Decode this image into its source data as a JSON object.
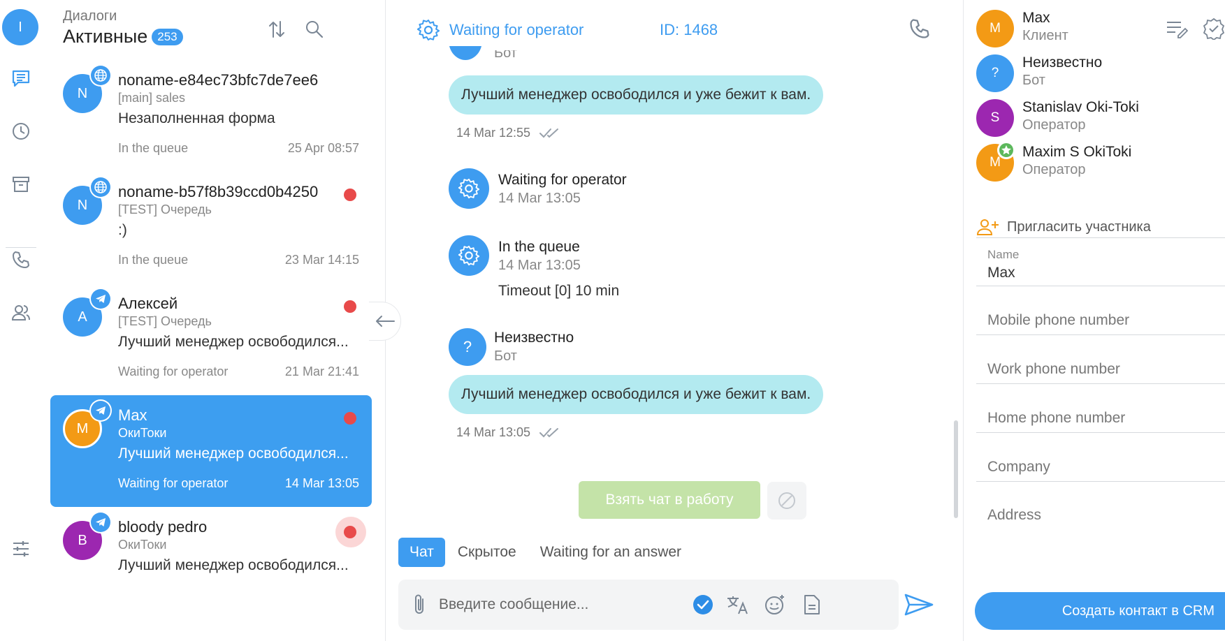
{
  "colors": {
    "accent": "#3e9cf0",
    "unread": "#e84a4a",
    "bubble": "#b3eaf0",
    "take_button": "#c4e3a8"
  },
  "user": {
    "initial": "I"
  },
  "rail": {
    "icons": [
      "chat-icon",
      "history-icon",
      "archive-icon",
      "phone-icon",
      "contacts-icon",
      "settings-sliders-icon"
    ]
  },
  "dialogs": {
    "section": "Диалоги",
    "title": "Активные",
    "count": "253",
    "items": [
      {
        "initial": "N",
        "avatar_color": "#3e9cf0",
        "channel": "web",
        "name": "noname-e84ec73bfc7de7ee6",
        "sub": "[main] sales",
        "message": "Незаполненная форма",
        "state": "In the queue",
        "date": "25 Apr 08:57",
        "unread": false
      },
      {
        "initial": "N",
        "avatar_color": "#3e9cf0",
        "channel": "web",
        "name": "noname-b57f8b39ccd0b4250",
        "sub": "[TEST] Очередь",
        "message": ":)",
        "state": "In the queue",
        "date": "23 Mar 14:15",
        "unread": true
      },
      {
        "initial": "A",
        "avatar_color": "#3e9cf0",
        "channel": "telegram",
        "name": "Алексей",
        "sub": "[TEST] Очередь",
        "message": "Лучший менеджер освободился...",
        "state": "Waiting for operator",
        "date": "21 Mar 21:41",
        "unread": true
      },
      {
        "initial": "M",
        "avatar_color": "#f39a15",
        "channel": "telegram",
        "name": "Max",
        "sub": "ОкиТоки",
        "message": "Лучший менеджер освободился...",
        "state": "Waiting for operator",
        "date": "14 Mar 13:05",
        "unread": true,
        "active": true
      },
      {
        "initial": "B",
        "avatar_color": "#9c27b0",
        "channel": "telegram",
        "name": "bloody pedro",
        "sub": "ОкиТоки",
        "message": "Лучший менеджер освободился...",
        "state": "",
        "date": "",
        "unread": true
      }
    ]
  },
  "chat": {
    "status": "Waiting for operator",
    "id": "ID: 1468",
    "partial_sender": "Бот",
    "messages": [
      {
        "text": "Лучший менеджер освободился и уже бежит к вам.",
        "time": "14 Mar 12:55"
      },
      {
        "text": "Лучший менеджер освободился и уже бежит к вам.",
        "time": "14 Mar 13:05"
      }
    ],
    "events": [
      {
        "title": "Waiting for operator",
        "time": "14 Mar 13:05"
      },
      {
        "title": "In the queue",
        "time": "14 Mar 13:05",
        "extra": "Timeout [0] 10 min"
      }
    ],
    "unknown_sender": {
      "initial": "?",
      "name": "Неизвестно",
      "role": "Бот"
    },
    "take_button": "Взять чат в работу",
    "tabs": [
      "Чат",
      "Скрытое",
      "Waiting for an answer"
    ],
    "composer_placeholder": "Введите сообщение..."
  },
  "members": [
    {
      "initial": "M",
      "name": "Max",
      "role": "Клиент",
      "color": "#f39a15"
    },
    {
      "initial": "?",
      "name": "Неизвестно",
      "role": "Бот",
      "color": "#3e9cf0"
    },
    {
      "initial": "S",
      "name": "Stanislav Oki-Toki",
      "role": "Оператор",
      "color": "#9c27b0"
    },
    {
      "initial": "M",
      "name": "Maxim S OkiToki",
      "role": "Оператор",
      "color": "#f39a15",
      "star": true
    }
  ],
  "invite_label": "Пригласить участника",
  "contact": {
    "name_label": "Name",
    "name_value": "Max",
    "fields": [
      "Mobile phone number",
      "Work phone number",
      "Home phone number",
      "Company",
      "Address"
    ],
    "crm_button": "Создать контакт в CRM"
  }
}
